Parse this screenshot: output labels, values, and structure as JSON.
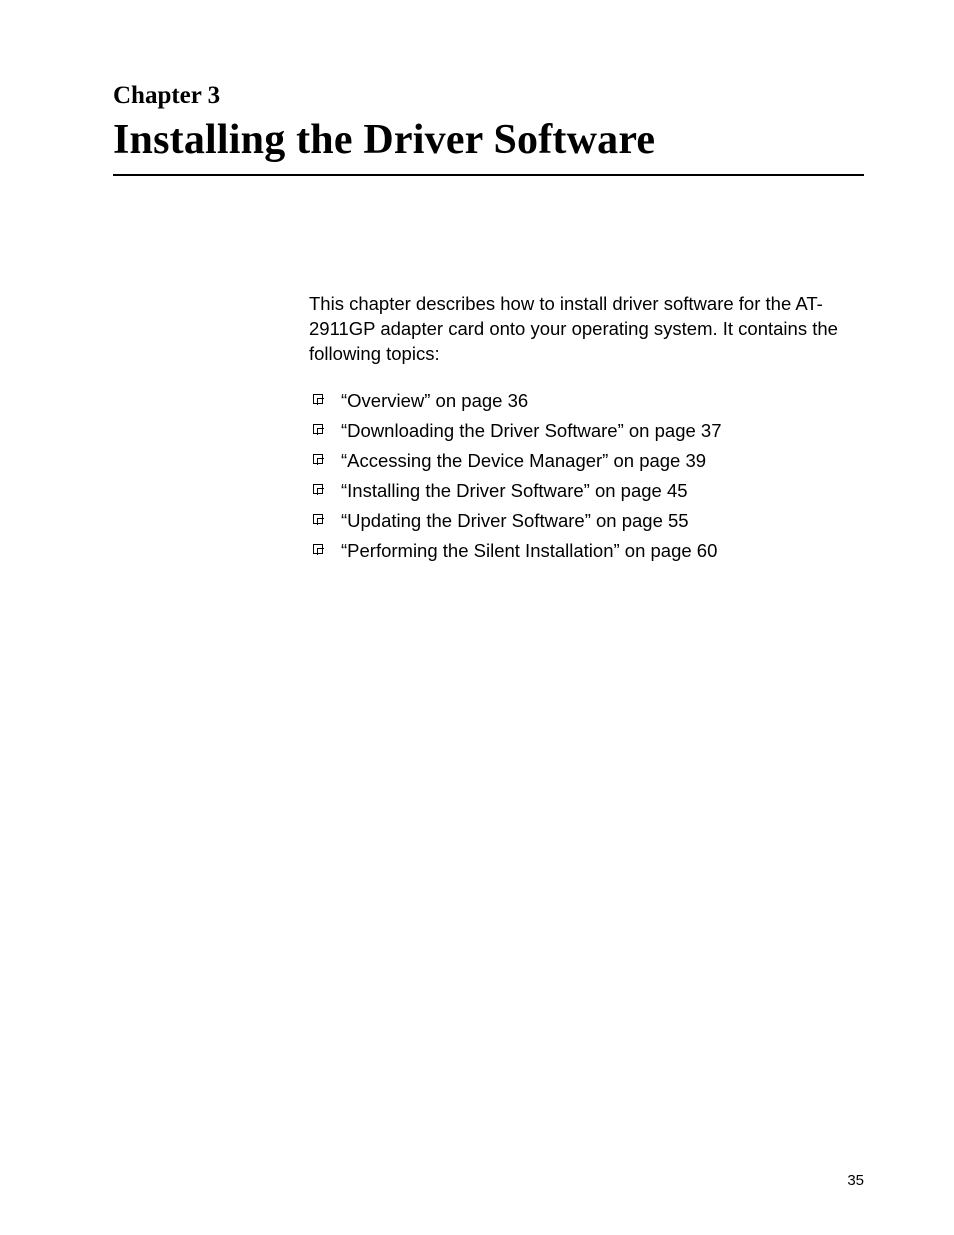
{
  "chapter": {
    "label": "Chapter 3",
    "title": "Installing the Driver Software"
  },
  "intro": "This chapter describes how to install driver software for the AT-2911GP adapter card onto your operating system. It contains the following topics:",
  "topics": [
    "“Overview” on page 36",
    "“Downloading the Driver Software” on page 37",
    "“Accessing the Device Manager” on page 39",
    "“Installing the Driver Software” on page 45",
    "“Updating the Driver Software” on page 55",
    "“Performing the Silent Installation” on page 60"
  ],
  "page_number": "35"
}
